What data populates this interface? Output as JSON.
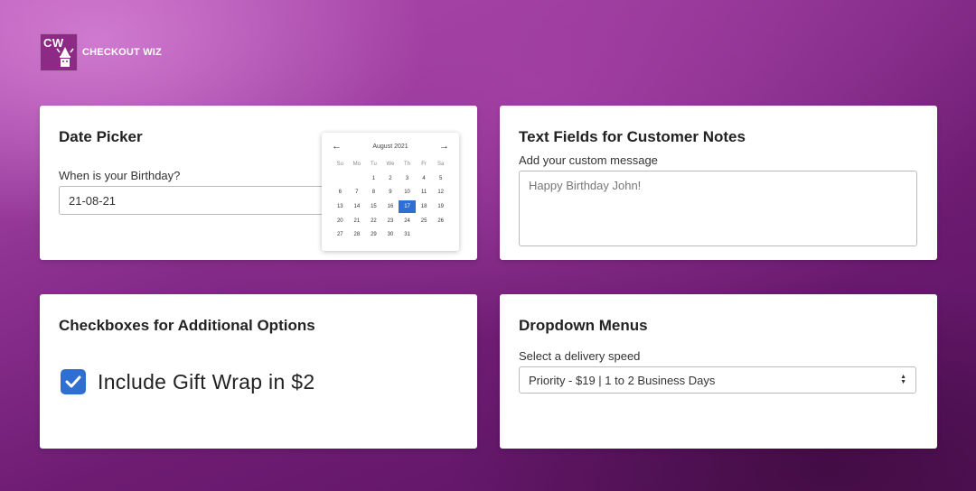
{
  "brand": {
    "logo_initials": "CW",
    "name": "CHECKOUT WIZ"
  },
  "date_picker": {
    "title": "Date Picker",
    "label": "When is your Birthday?",
    "value": "21-08-21",
    "calendar": {
      "month": "August 2021",
      "prev_arrow": "←",
      "next_arrow": "→",
      "weekdays": [
        "Su",
        "Mo",
        "Tu",
        "We",
        "Th",
        "Fr",
        "Sa"
      ],
      "weeks": [
        [
          "",
          "",
          "1",
          "2",
          "3",
          "4",
          "5"
        ],
        [
          "6",
          "7",
          "8",
          "9",
          "10",
          "11",
          "12"
        ],
        [
          "13",
          "14",
          "15",
          "16",
          "17",
          "18",
          "19"
        ],
        [
          "20",
          "21",
          "22",
          "23",
          "24",
          "25",
          "26"
        ],
        [
          "27",
          "28",
          "29",
          "30",
          "31",
          "",
          ""
        ]
      ],
      "selected_day": "17",
      "accent": "#2f6fd1"
    }
  },
  "text_fields": {
    "title": "Text Fields for Customer Notes",
    "label": "Add your custom message",
    "placeholder": "Happy Birthday John!"
  },
  "checkboxes": {
    "title": "Checkboxes for Additional Options",
    "option_label": "Include Gift Wrap in $2",
    "checked": true
  },
  "dropdown": {
    "title": "Dropdown Menus",
    "label": "Select a delivery speed",
    "selected": "Priority - $19 | 1 to 2 Business Days"
  }
}
